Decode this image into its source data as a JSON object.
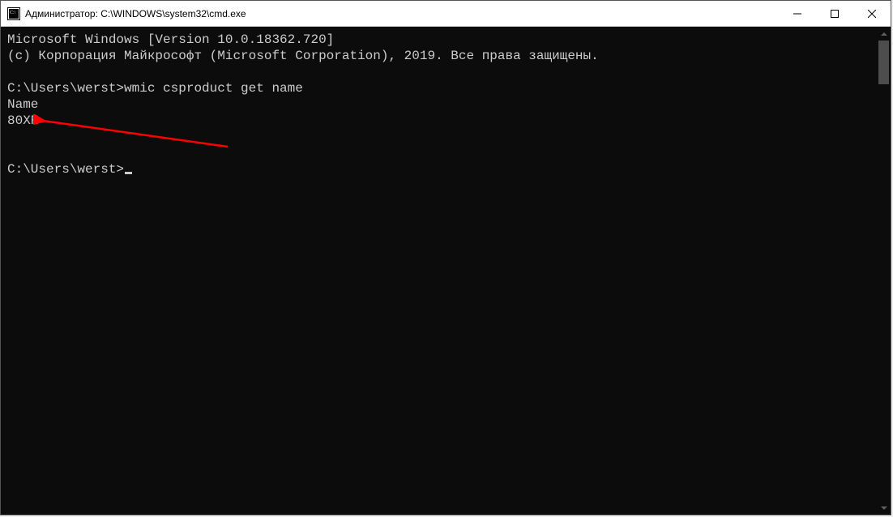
{
  "window": {
    "title": "Администратор: C:\\WINDOWS\\system32\\cmd.exe"
  },
  "terminal": {
    "lines": [
      "Microsoft Windows [Version 10.0.18362.720]",
      "(c) Корпорация Майкрософт (Microsoft Corporation), 2019. Все права защищены.",
      "",
      "C:\\Users\\werst>wmic csproduct get name",
      "Name",
      "80XR",
      "",
      "",
      "C:\\Users\\werst>"
    ],
    "prompt_index_with_cursor": 8
  },
  "annotation": {
    "arrow_color": "#ff0000",
    "target_value": "80XR"
  }
}
